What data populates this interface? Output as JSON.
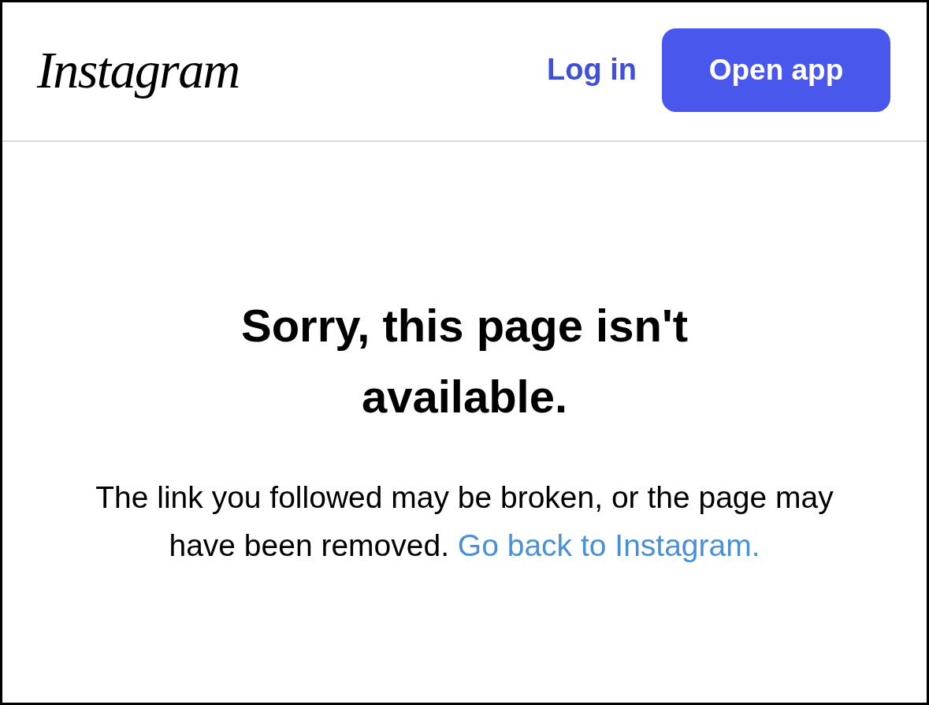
{
  "header": {
    "logo": "Instagram",
    "login_link": "Log in",
    "open_app_button": "Open app"
  },
  "error": {
    "title": "Sorry, this page isn't available.",
    "message": "The link you followed may be broken, or the page may have been removed.",
    "link": "Go back to Instagram."
  }
}
